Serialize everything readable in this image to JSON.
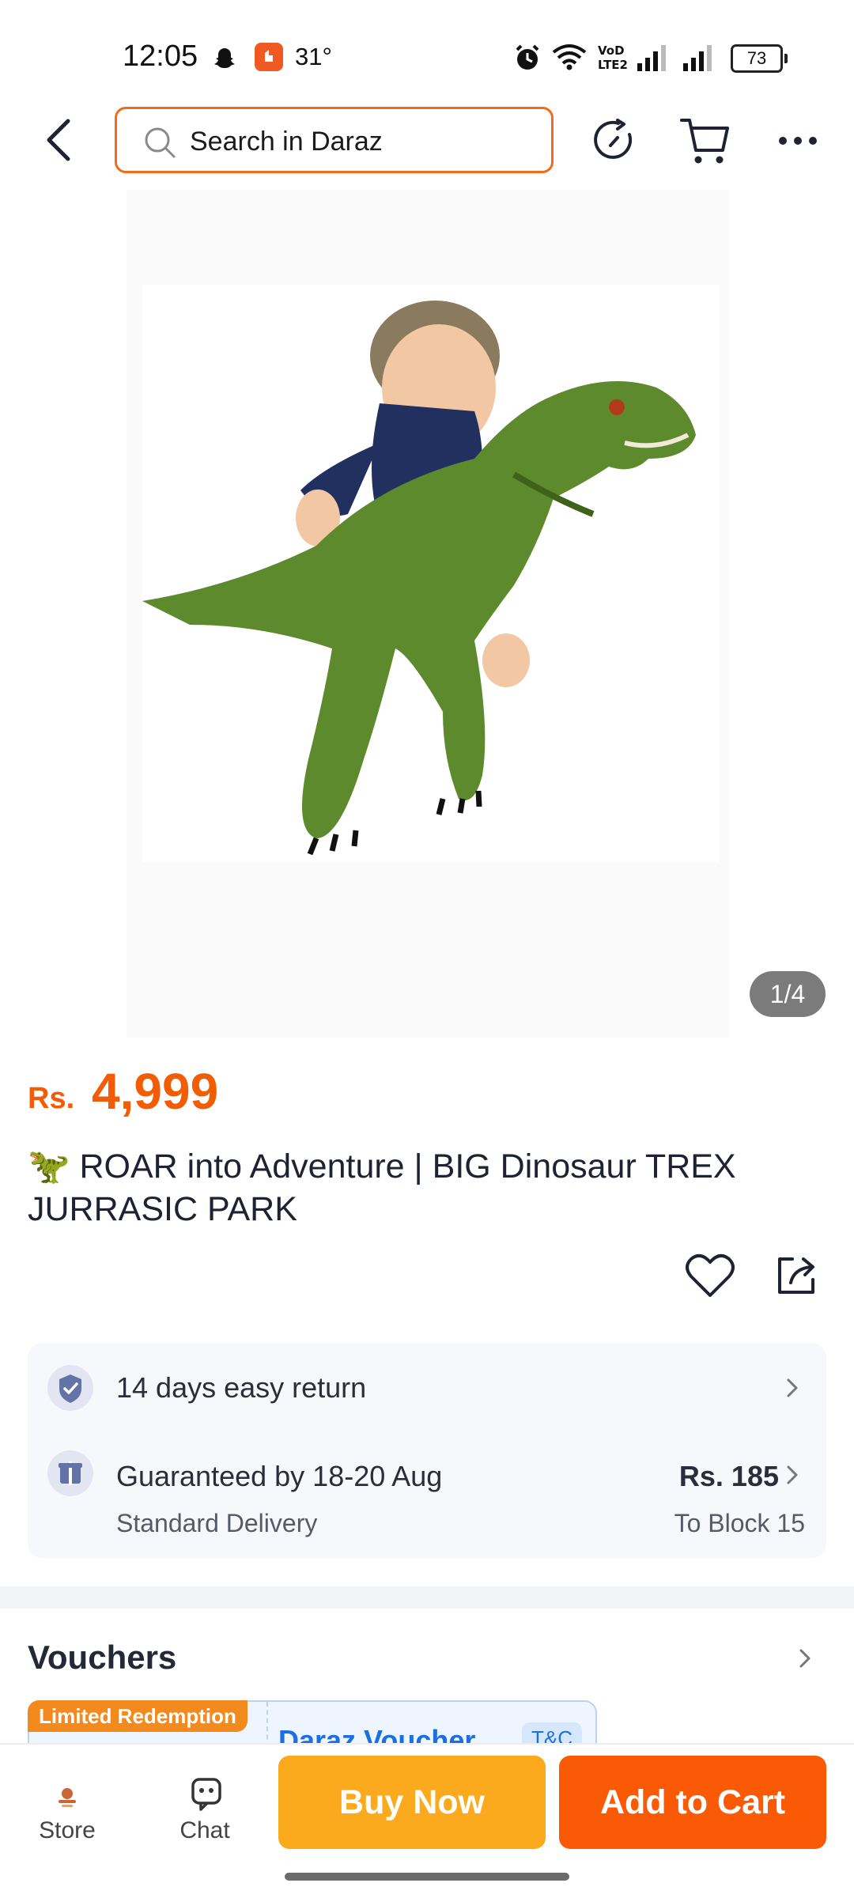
{
  "status_bar": {
    "time": "12:05",
    "temperature": "31°",
    "battery": "73",
    "icons": [
      "snapchat-icon",
      "notification-app-icon",
      "alarm-icon",
      "wifi-icon",
      "volte-icon",
      "signal-icon",
      "signal-icon",
      "battery-icon"
    ]
  },
  "top_nav": {
    "search_placeholder": "Search in Daraz",
    "icons": [
      "back-arrow-icon",
      "search-icon",
      "refresh-icon",
      "cart-icon",
      "more-icon"
    ]
  },
  "product": {
    "image_counter": "1/4",
    "price_currency": "Rs.",
    "price_amount": "4,999",
    "title": "🦖 ROAR into Adventure | BIG Dinosaur TREX JURRASIC PARK"
  },
  "info": {
    "return_text": "14 days easy return",
    "delivery_text": "Guaranteed by 18-20 Aug",
    "delivery_sub": "Standard Delivery",
    "delivery_price": "Rs. 185",
    "delivery_location": "To Block 15"
  },
  "vouchers": {
    "title": "Vouchers",
    "badge": "Limited Redemption",
    "voucher_name": "Daraz Voucher",
    "tc": "T&C"
  },
  "bottom_bar": {
    "store_label": "Store",
    "chat_label": "Chat",
    "buy_now_label": "Buy Now",
    "add_to_cart_label": "Add to Cart"
  },
  "colors": {
    "accent_orange": "#fa5a05",
    "buy_now_yellow": "#fbaa1d",
    "search_border": "#f26b1d",
    "price": "#f25c05"
  }
}
